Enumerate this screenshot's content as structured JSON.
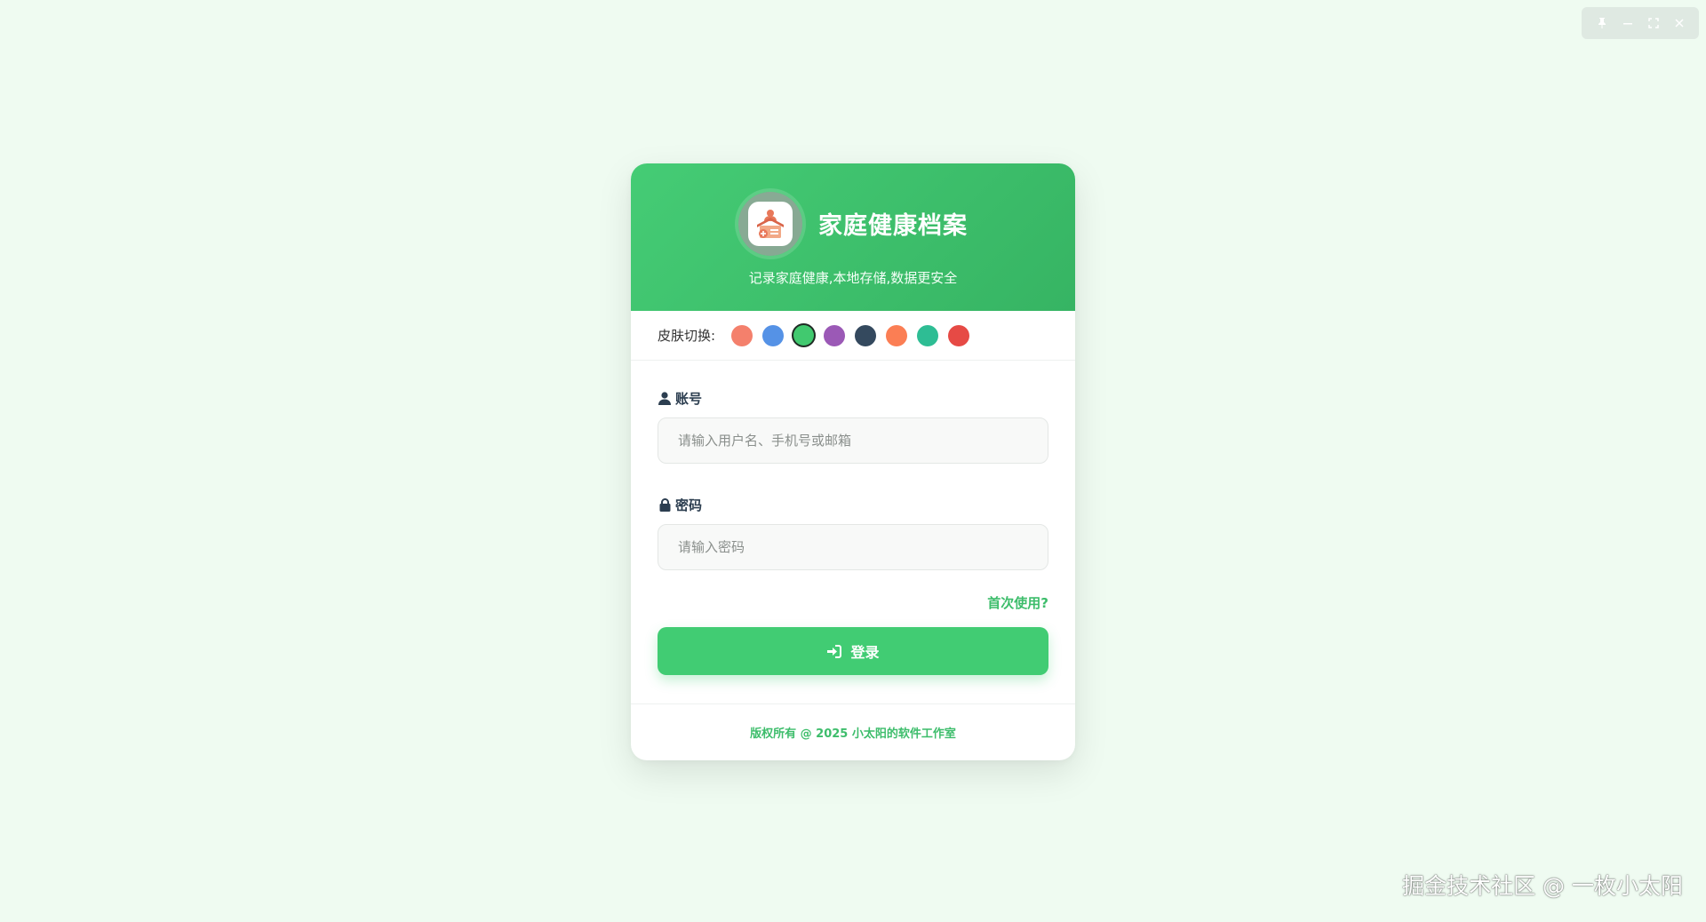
{
  "window_controls": {
    "icons": [
      "pin-icon",
      "minimize-icon",
      "maximize-icon",
      "close-icon"
    ]
  },
  "header": {
    "logo_icon": "family-health-icon",
    "title": "家庭健康档案",
    "subtitle": "记录家庭健康,本地存储,数据更安全"
  },
  "skin": {
    "label": "皮肤切换:",
    "swatches": [
      {
        "color": "#f4806c",
        "active": false
      },
      {
        "color": "#5592e6",
        "active": false
      },
      {
        "color": "#41c96f",
        "active": true
      },
      {
        "color": "#9b59b6",
        "active": false
      },
      {
        "color": "#34495e",
        "active": false
      },
      {
        "color": "#fb7e54",
        "active": false
      },
      {
        "color": "#2ebd94",
        "active": false
      },
      {
        "color": "#e64a45",
        "active": false
      }
    ]
  },
  "form": {
    "account": {
      "label": "账号",
      "icon": "user-icon",
      "placeholder": "请输入用户名、手机号或邮箱",
      "value": ""
    },
    "password": {
      "label": "密码",
      "icon": "lock-icon",
      "placeholder": "请输入密码",
      "value": ""
    },
    "first_use_link": "首次使用?",
    "login_button": "登录"
  },
  "footer": {
    "copyright": "版权所有 @ 2025 小太阳的软件工作室"
  },
  "watermark": "掘金技术社区 @ 一枚小太阳",
  "colors": {
    "page_bg": "#effbf1",
    "accent": "#41cc73",
    "header_gradient_start": "#45cc75",
    "header_gradient_end": "#36b463"
  }
}
